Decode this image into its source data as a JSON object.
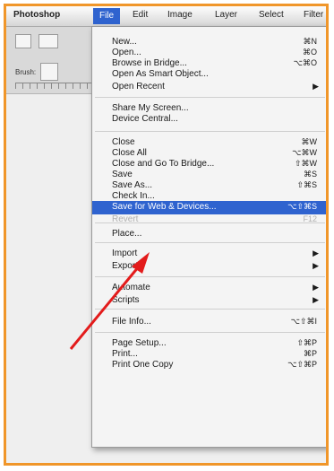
{
  "menubar": {
    "app": "Photoshop",
    "items": [
      "File",
      "Edit",
      "Image",
      "Layer",
      "Select",
      "Filter"
    ]
  },
  "toolbar": {
    "brush_label": "Brush:"
  },
  "file_menu": {
    "items": [
      {
        "label": "New...",
        "shortcut": "⌘N"
      },
      {
        "label": "Open...",
        "shortcut": "⌘O"
      },
      {
        "label": "Browse in Bridge...",
        "shortcut": "⌥⌘O"
      },
      {
        "label": "Open As Smart Object...",
        "shortcut": ""
      },
      {
        "label": "Open Recent",
        "shortcut": "",
        "submenu": true
      },
      {
        "label": "Share My Screen...",
        "shortcut": ""
      },
      {
        "label": "Device Central...",
        "shortcut": ""
      },
      {
        "label": "Close",
        "shortcut": "⌘W"
      },
      {
        "label": "Close All",
        "shortcut": "⌥⌘W"
      },
      {
        "label": "Close and Go To Bridge...",
        "shortcut": "⇧⌘W"
      },
      {
        "label": "Save",
        "shortcut": "⌘S"
      },
      {
        "label": "Save As...",
        "shortcut": "⇧⌘S"
      },
      {
        "label": "Check In...",
        "shortcut": ""
      },
      {
        "label": "Save for Web & Devices...",
        "shortcut": "⌥⇧⌘S"
      },
      {
        "label": "Revert",
        "shortcut": "F12"
      },
      {
        "label": "Place...",
        "shortcut": ""
      },
      {
        "label": "Import",
        "shortcut": "",
        "submenu": true
      },
      {
        "label": "Export",
        "shortcut": "",
        "submenu": true
      },
      {
        "label": "Automate",
        "shortcut": "",
        "submenu": true
      },
      {
        "label": "Scripts",
        "shortcut": "",
        "submenu": true
      },
      {
        "label": "File Info...",
        "shortcut": "⌥⇧⌘I"
      },
      {
        "label": "Page Setup...",
        "shortcut": "⇧⌘P"
      },
      {
        "label": "Print...",
        "shortcut": "⌘P"
      },
      {
        "label": "Print One Copy",
        "shortcut": "⌥⇧⌘P"
      }
    ],
    "submenu_glyph": "▶"
  },
  "colors": {
    "highlight": "#2f63cf",
    "frame": "#f0962a",
    "arrow": "#e31b1b"
  }
}
